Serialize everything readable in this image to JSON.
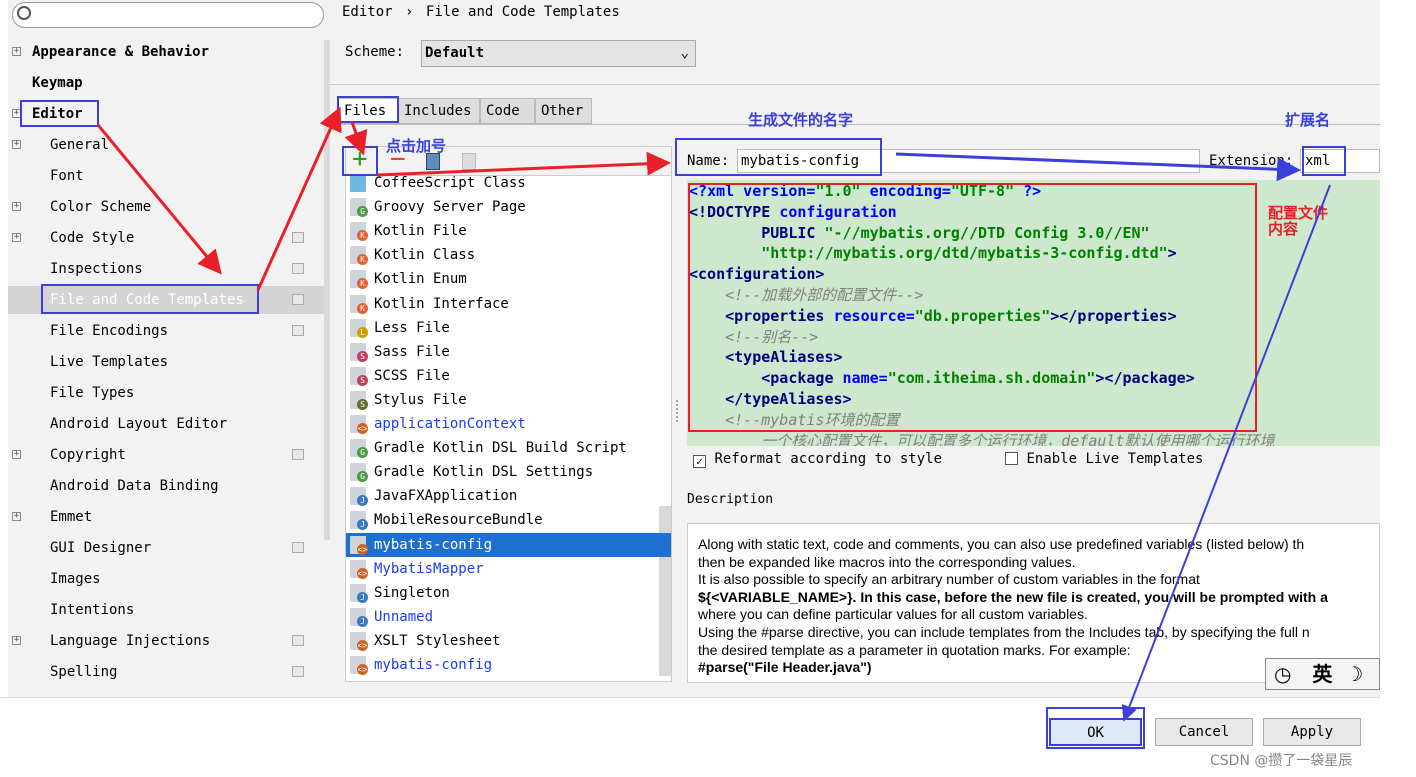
{
  "sidebar": {
    "search_placeholder": "",
    "items": [
      {
        "label": "Appearance & Behavior",
        "bold": true,
        "exp": true
      },
      {
        "label": "Keymap",
        "bold": true
      },
      {
        "label": "Editor",
        "bold": true,
        "exp": true
      },
      {
        "label": "General",
        "exp": true,
        "indent": true
      },
      {
        "label": "Font",
        "indent": true
      },
      {
        "label": "Color Scheme",
        "exp": true,
        "indent": true
      },
      {
        "label": "Code Style",
        "exp": true,
        "indent": true,
        "cfg": true
      },
      {
        "label": "Inspections",
        "indent": true,
        "cfg": true
      },
      {
        "label": "File and Code Templates",
        "indent": true,
        "cfg": true,
        "selected": true
      },
      {
        "label": "File Encodings",
        "indent": true,
        "cfg": true
      },
      {
        "label": "Live Templates",
        "indent": true
      },
      {
        "label": "File Types",
        "indent": true
      },
      {
        "label": "Android Layout Editor",
        "indent": true
      },
      {
        "label": "Copyright",
        "exp": true,
        "indent": true,
        "cfg": true
      },
      {
        "label": "Android Data Binding",
        "indent": true
      },
      {
        "label": "Emmet",
        "exp": true,
        "indent": true
      },
      {
        "label": "GUI Designer",
        "indent": true,
        "cfg": true
      },
      {
        "label": "Images",
        "indent": true
      },
      {
        "label": "Intentions",
        "indent": true
      },
      {
        "label": "Language Injections",
        "exp": true,
        "indent": true,
        "cfg": true
      },
      {
        "label": "Spelling",
        "indent": true,
        "cfg": true
      }
    ]
  },
  "breadcrumb": {
    "parent": "Editor",
    "sep": "›",
    "current": "File and Code Templates"
  },
  "scheme": {
    "label": "Scheme:",
    "value": "Default"
  },
  "tabs": [
    "Files",
    "Includes",
    "Code",
    "Other"
  ],
  "toolbar": {
    "add": "+",
    "remove": "−"
  },
  "files": [
    {
      "label": "CoffeeScript Class",
      "icon": "coffeescript-icon"
    },
    {
      "label": "Groovy Server Page",
      "icon": "groovy-icon",
      "badge": "G",
      "bc": "#4a9a4a"
    },
    {
      "label": "Kotlin File",
      "icon": "kotlin-icon",
      "badge": "K",
      "bc": "#e06030"
    },
    {
      "label": "Kotlin Class",
      "icon": "kotlin-icon",
      "badge": "K",
      "bc": "#e06030"
    },
    {
      "label": "Kotlin Enum",
      "icon": "kotlin-icon",
      "badge": "K",
      "bc": "#e06030"
    },
    {
      "label": "Kotlin Interface",
      "icon": "kotlin-icon",
      "badge": "K",
      "bc": "#e06030"
    },
    {
      "label": "Less File",
      "icon": "less-icon",
      "badge": "L",
      "bc": "#c9a000"
    },
    {
      "label": "Sass File",
      "icon": "sass-icon",
      "badge": "S",
      "bc": "#c04060"
    },
    {
      "label": "SCSS File",
      "icon": "scss-icon",
      "badge": "S",
      "bc": "#c04060"
    },
    {
      "label": "Stylus File",
      "icon": "stylus-icon",
      "badge": "S",
      "bc": "#607030"
    },
    {
      "label": "applicationContext",
      "icon": "xml-icon",
      "badge": "<>",
      "bc": "#d06020",
      "blue": true
    },
    {
      "label": "Gradle Kotlin DSL Build Script",
      "icon": "gradle-icon",
      "badge": "G",
      "bc": "#4a9a4a"
    },
    {
      "label": "Gradle Kotlin DSL Settings",
      "icon": "gradle-icon",
      "badge": "G",
      "bc": "#4a9a4a"
    },
    {
      "label": "JavaFXApplication",
      "icon": "java-icon",
      "badge": "J",
      "bc": "#3a78c0"
    },
    {
      "label": "MobileResourceBundle",
      "icon": "java-icon",
      "badge": "J",
      "bc": "#3a78c0"
    },
    {
      "label": "mybatis-config",
      "icon": "xml-icon",
      "badge": "<>",
      "bc": "#d06020",
      "selected": true
    },
    {
      "label": "MybatisMapper",
      "icon": "xml-icon",
      "badge": "<>",
      "bc": "#d06020",
      "blue": true
    },
    {
      "label": "Singleton",
      "icon": "java-icon",
      "badge": "J",
      "bc": "#3a78c0"
    },
    {
      "label": "Unnamed",
      "icon": "java-icon",
      "badge": "J",
      "bc": "#3a78c0",
      "blue": true
    },
    {
      "label": "XSLT Stylesheet",
      "icon": "xml-icon",
      "badge": "<>",
      "bc": "#d06020"
    },
    {
      "label": "mybatis-config",
      "icon": "xml-icon",
      "badge": "<>",
      "bc": "#d06020",
      "blue": true
    }
  ],
  "name_field": {
    "label": "Name:",
    "value": "mybatis-config"
  },
  "extension_field": {
    "label": "Extension:",
    "value": "xml"
  },
  "code_lines": [
    [
      [
        "at",
        "<?"
      ],
      [
        "at",
        "xml version="
      ],
      [
        "st",
        "\"1.0\""
      ],
      [
        "at",
        " encoding="
      ],
      [
        "st",
        "\"UTF-8\""
      ],
      [
        "at",
        " ?>"
      ]
    ],
    [
      [
        "tg",
        "<!DOCTYPE "
      ],
      [
        "at",
        "configuration"
      ]
    ],
    [
      [
        "tg",
        "        PUBLIC "
      ],
      [
        "st",
        "\"-//mybatis.org//DTD Config 3.0//EN\""
      ]
    ],
    [
      [
        "st",
        "        \"http://mybatis.org/dtd/mybatis-3-config.dtd\""
      ],
      [
        "tg",
        ">"
      ]
    ],
    [
      [
        "tg",
        "<configuration>"
      ]
    ],
    [
      [
        "cm",
        "    <!--加载外部的配置文件-->"
      ]
    ],
    [
      [
        "tg",
        "    <properties "
      ],
      [
        "at",
        "resource="
      ],
      [
        "st",
        "\"db.properties\""
      ],
      [
        "tg",
        "></properties>"
      ]
    ],
    [
      [
        "cm",
        "    <!--别名-->"
      ]
    ],
    [
      [
        "tg",
        "    <typeAliases>"
      ]
    ],
    [
      [
        "tg",
        "        <package "
      ],
      [
        "at",
        "name="
      ],
      [
        "st",
        "\"com.itheima.sh.domain\""
      ],
      [
        "tg",
        "></package>"
      ]
    ],
    [
      [
        "tg",
        "    </typeAliases>"
      ]
    ],
    [
      [
        "cm",
        "    <!--mybatis环境的配置"
      ]
    ],
    [
      [
        "cm",
        "        一个核心配置文件，可以配置多个运行环境，default默认使用哪个运行环境"
      ]
    ]
  ],
  "options": {
    "reformat": "Reformat according to style",
    "reformat_checked": true,
    "live": "Enable Live Templates",
    "live_checked": false
  },
  "description": {
    "label": "Description",
    "lines": [
      "Along with static text, code and comments, you can also use predefined variables (listed below) th",
      "then be expanded like macros into the corresponding values.",
      "It is also possible to specify an arbitrary number of custom variables in the format",
      "${<VARIABLE_NAME>}. In this case, before the new file is created, you will be prompted with a",
      "where you can define particular values for all custom variables.",
      "Using the #parse directive, you can include templates from the Includes tab, by specifying the full n",
      "the desired template as a parameter in quotation marks. For example:",
      "#parse(\"File Header.java\")"
    ]
  },
  "buttons": {
    "ok": "OK",
    "cancel": "Cancel",
    "apply": "Apply"
  },
  "ime": {
    "lang": "英"
  },
  "annotations": {
    "click_plus": "点击加号",
    "file_name": "生成文件的名字",
    "extension": "扩展名",
    "content": "配置文件内容"
  },
  "watermark": "CSDN @攒了一袋星辰",
  "colors": {
    "annotation_red": "#e8202a",
    "annotation_blue": "#3a40d8",
    "selection": "#1e6fd0",
    "editor_bg": "#cde8cd"
  }
}
